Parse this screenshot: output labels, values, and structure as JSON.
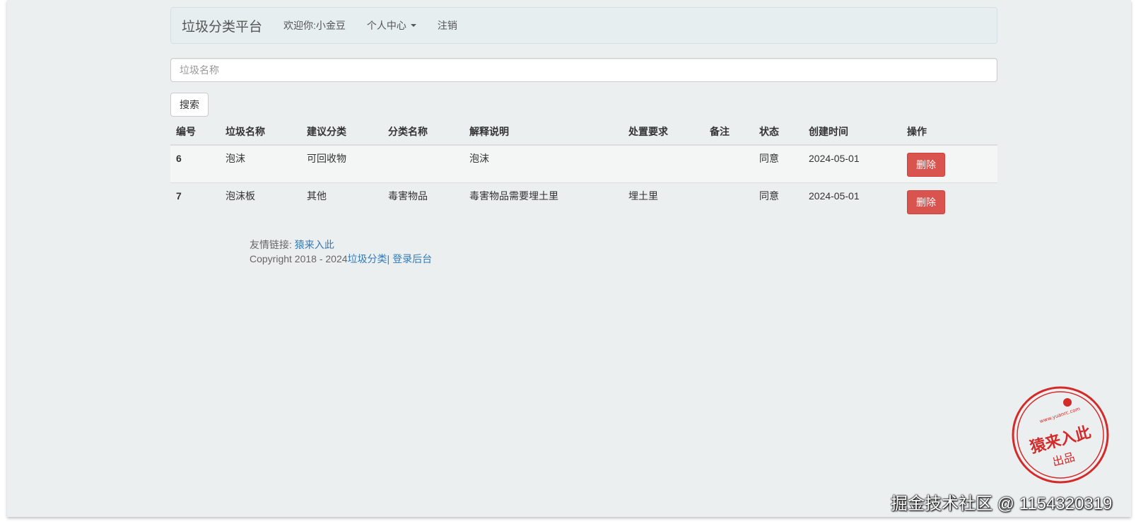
{
  "navbar": {
    "brand": "垃圾分类平台",
    "welcome": "欢迎你:小金豆",
    "personal_center": "个人中心",
    "logout": "注销"
  },
  "search": {
    "placeholder": "垃圾名称",
    "button_label": "搜索"
  },
  "table": {
    "headers": [
      "编号",
      "垃圾名称",
      "建议分类",
      "分类名称",
      "解释说明",
      "处置要求",
      "备注",
      "状态",
      "创建时间",
      "操作"
    ],
    "rows": [
      {
        "id": "6",
        "name": "泡沫",
        "suggest": "可回收物",
        "category": "",
        "explain": "泡沫",
        "disposal": "",
        "note": "",
        "status": "同意",
        "created": "2024-05-01",
        "action": "删除"
      },
      {
        "id": "7",
        "name": "泡沫板",
        "suggest": "其他",
        "category": "毒害物品",
        "explain": "毒害物品需要埋土里",
        "disposal": "埋土里",
        "note": "",
        "status": "同意",
        "created": "2024-05-01",
        "action": "删除"
      }
    ]
  },
  "footer": {
    "links_label": "友情链接:",
    "links_value": "猿来入此",
    "copyright_prefix": "Copyright 2018 - 2024",
    "site_link": "垃圾分类",
    "separator": "|",
    "admin_link": "登录后台"
  },
  "stamp": {
    "url": "www.yuanrc.com",
    "name": "猿来入此",
    "suffix": "出品"
  },
  "watermark": "掘金技术社区 @ 1154320319",
  "colors": {
    "page_bg": "#ebeff0",
    "danger": "#d9534f",
    "link": "#337ab7",
    "stamp_red": "#d32a2a"
  }
}
